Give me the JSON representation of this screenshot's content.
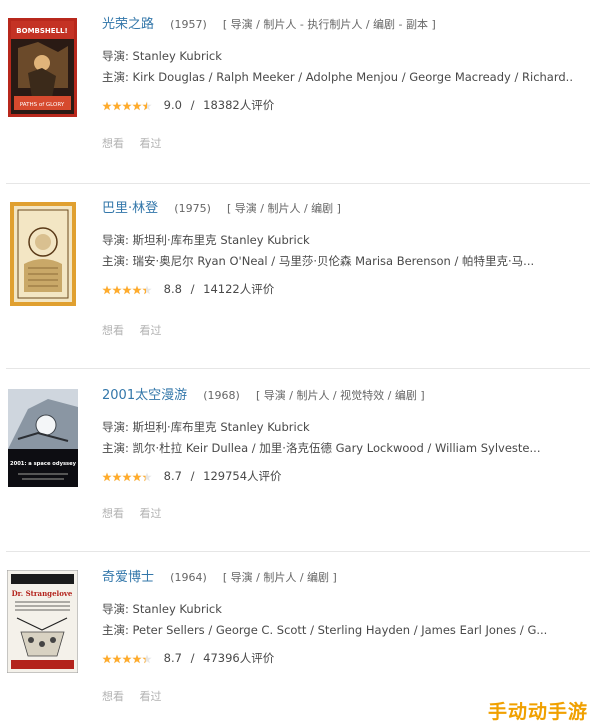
{
  "movies": [
    {
      "title": "光荣之路",
      "year": "(1957)",
      "roles": "[ 导演 / 制片人 - 执行制片人 / 编剧 - 副本 ]",
      "director": "导演: Stanley Kubrick",
      "cast": "主演: Kirk Douglas / Ralph Meeker / Adolphe Menjou / George Macready / Richard...",
      "rating": "9.0",
      "rating_fraction": 0.9,
      "votes": "18382人评价",
      "poster_text": "BOMBSHELL!",
      "poster_caption": "PATHS of GLORY",
      "action_1": "想看",
      "action_2": "看过"
    },
    {
      "title": "巴里·林登",
      "year": "(1975)",
      "roles": "[ 导演 / 制片人 / 编剧 ]",
      "director": "导演: 斯坦利·库布里克 Stanley Kubrick",
      "cast": "主演: 瑞安·奥尼尔 Ryan O'Neal / 马里莎·贝伦森 Marisa Berenson / 帕特里克·马...",
      "rating": "8.8",
      "rating_fraction": 0.88,
      "votes": "14122人评价",
      "action_1": "想看",
      "action_2": "看过"
    },
    {
      "title": "2001太空漫游",
      "year": "(1968)",
      "roles": "[ 导演 / 制片人 / 视觉特效 / 编剧 ]",
      "director": "导演: 斯坦利·库布里克 Stanley Kubrick",
      "cast": "主演: 凯尔·杜拉 Keir Dullea / 加里·洛克伍德 Gary Lockwood / William Sylveste...",
      "rating": "8.7",
      "rating_fraction": 0.87,
      "votes": "129754人评价",
      "poster_caption": "2001: a space odyssey",
      "action_1": "想看",
      "action_2": "看过"
    },
    {
      "title": "奇爱博士",
      "year": "(1964)",
      "roles": "[ 导演 / 制片人 / 编剧 ]",
      "director": "导演: Stanley Kubrick",
      "cast": "主演: Peter Sellers / George C. Scott / Sterling Hayden / James Earl Jones / G...",
      "rating": "8.7",
      "rating_fraction": 0.87,
      "votes": "47396人评价",
      "poster_text": "Dr. Strangelove",
      "action_1": "想看",
      "action_2": "看过"
    }
  ],
  "watermark": "手动动手游",
  "colors": {
    "title": "#3377aa",
    "star": "#ffac2d",
    "muted": "#b2b2b2"
  }
}
